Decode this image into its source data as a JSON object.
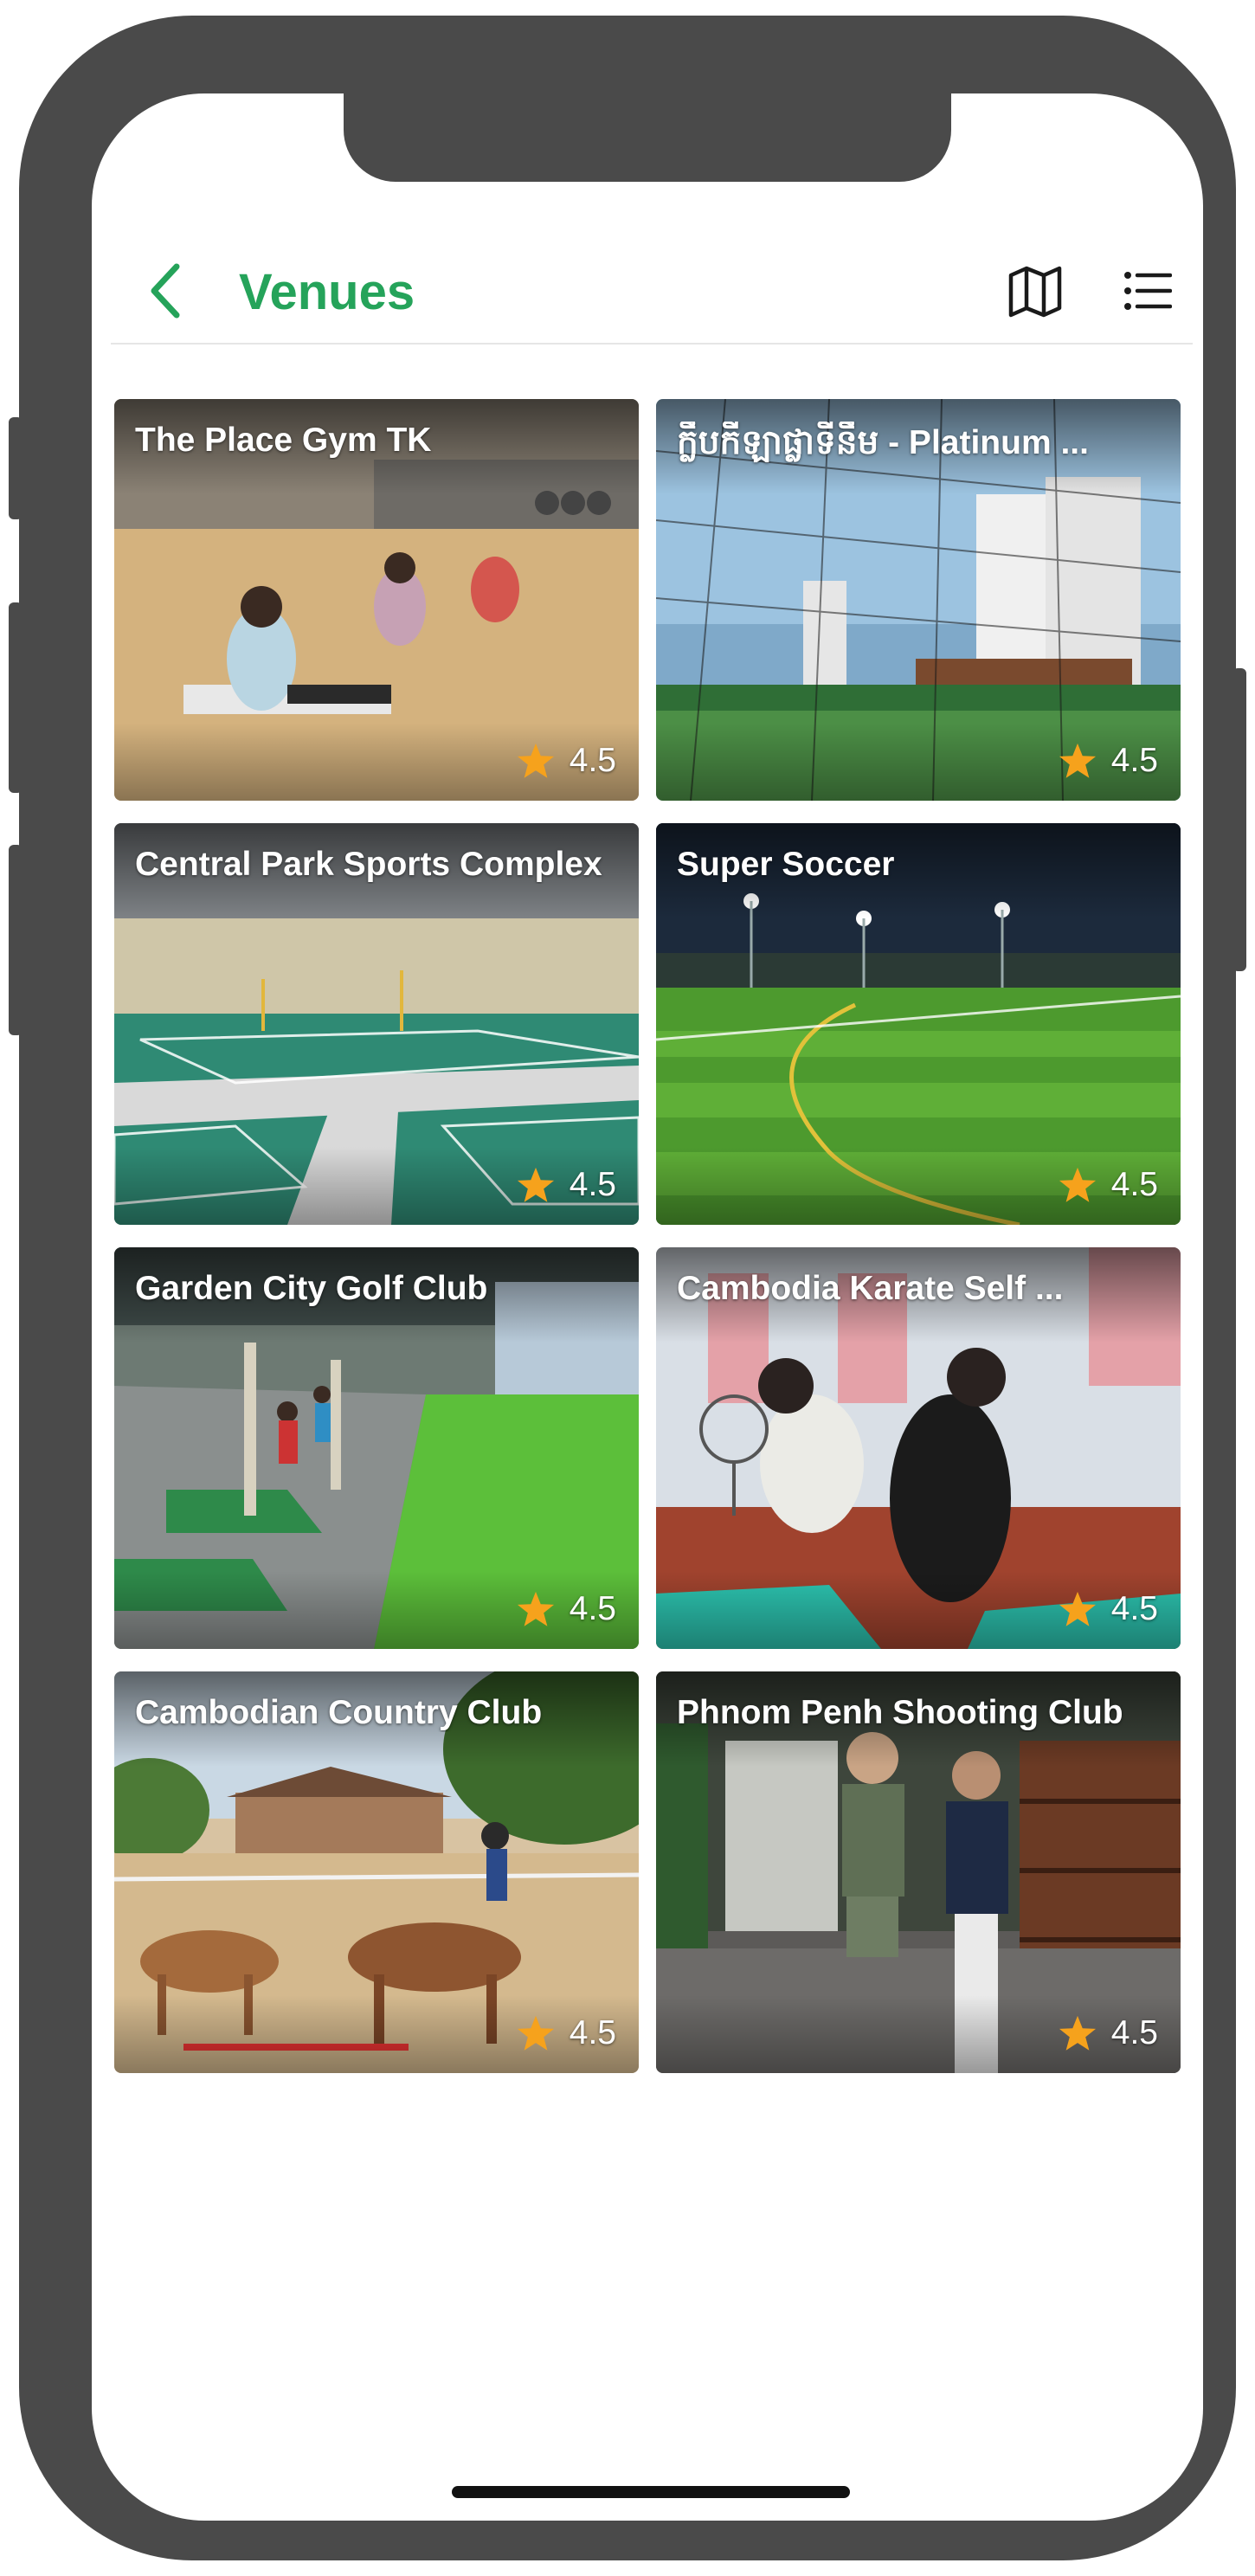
{
  "header": {
    "title": "Venues"
  },
  "icons": {
    "back": "chevron-left-icon",
    "map": "map-icon",
    "list": "list-icon",
    "rating": "star-icon"
  },
  "colors": {
    "brand_green": "#25a35a",
    "star": "#f6a21c",
    "frame": "#4a4a4a"
  },
  "venues": [
    {
      "name": "The Place Gym TK",
      "rating": "4.5",
      "photo": "gym fitness class"
    },
    {
      "name": "ក្លឹបកីឡាផ្លាទីនឹម - Platinum ...",
      "rating": "4.5",
      "photo": "football field with net"
    },
    {
      "name": "Central Park Sports Complex",
      "rating": "4.5",
      "photo": "indoor badminton courts"
    },
    {
      "name": "Super Soccer",
      "rating": "4.5",
      "photo": "night football pitch"
    },
    {
      "name": "Garden City Golf Club",
      "rating": "4.5",
      "photo": "golf driving range"
    },
    {
      "name": "Cambodia Karate Self ...",
      "rating": "4.5",
      "photo": "self defense training"
    },
    {
      "name": "Cambodian Country Club",
      "rating": "4.5",
      "photo": "horse riding arena"
    },
    {
      "name": "Phnom Penh Shooting Club",
      "rating": "4.5",
      "photo": "shooting club interior"
    }
  ]
}
